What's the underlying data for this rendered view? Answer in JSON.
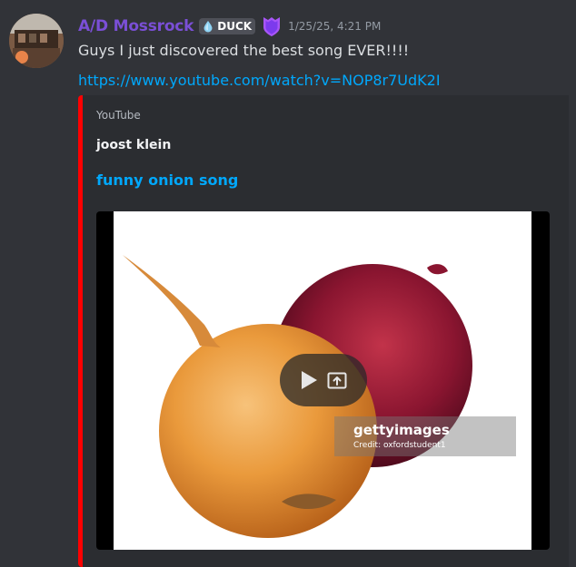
{
  "message": {
    "author": "A/D Mossrock",
    "tag": "DUCK",
    "timestamp": "1/25/25, 4:21 PM",
    "text": "Guys I just discovered the best song EVER!!!!",
    "link": "https://www.youtube.com/watch?v=NOP8r7UdK2I"
  },
  "embed": {
    "provider": "YouTube",
    "author": "joost klein",
    "title": "funny onion song",
    "accent_color": "#ff0000",
    "watermark_brand": "gettyimages",
    "watermark_credit": "Credit: oxfordstudent1"
  },
  "icons": {
    "tag_icon": "water-drop-icon",
    "role_icon": "purple-shield-icon",
    "play": "play-icon",
    "open_external": "open-external-icon"
  },
  "colors": {
    "username": "#7a4fd6",
    "link": "#00a8fc",
    "background": "#313338",
    "embed_background": "#2b2d31"
  }
}
